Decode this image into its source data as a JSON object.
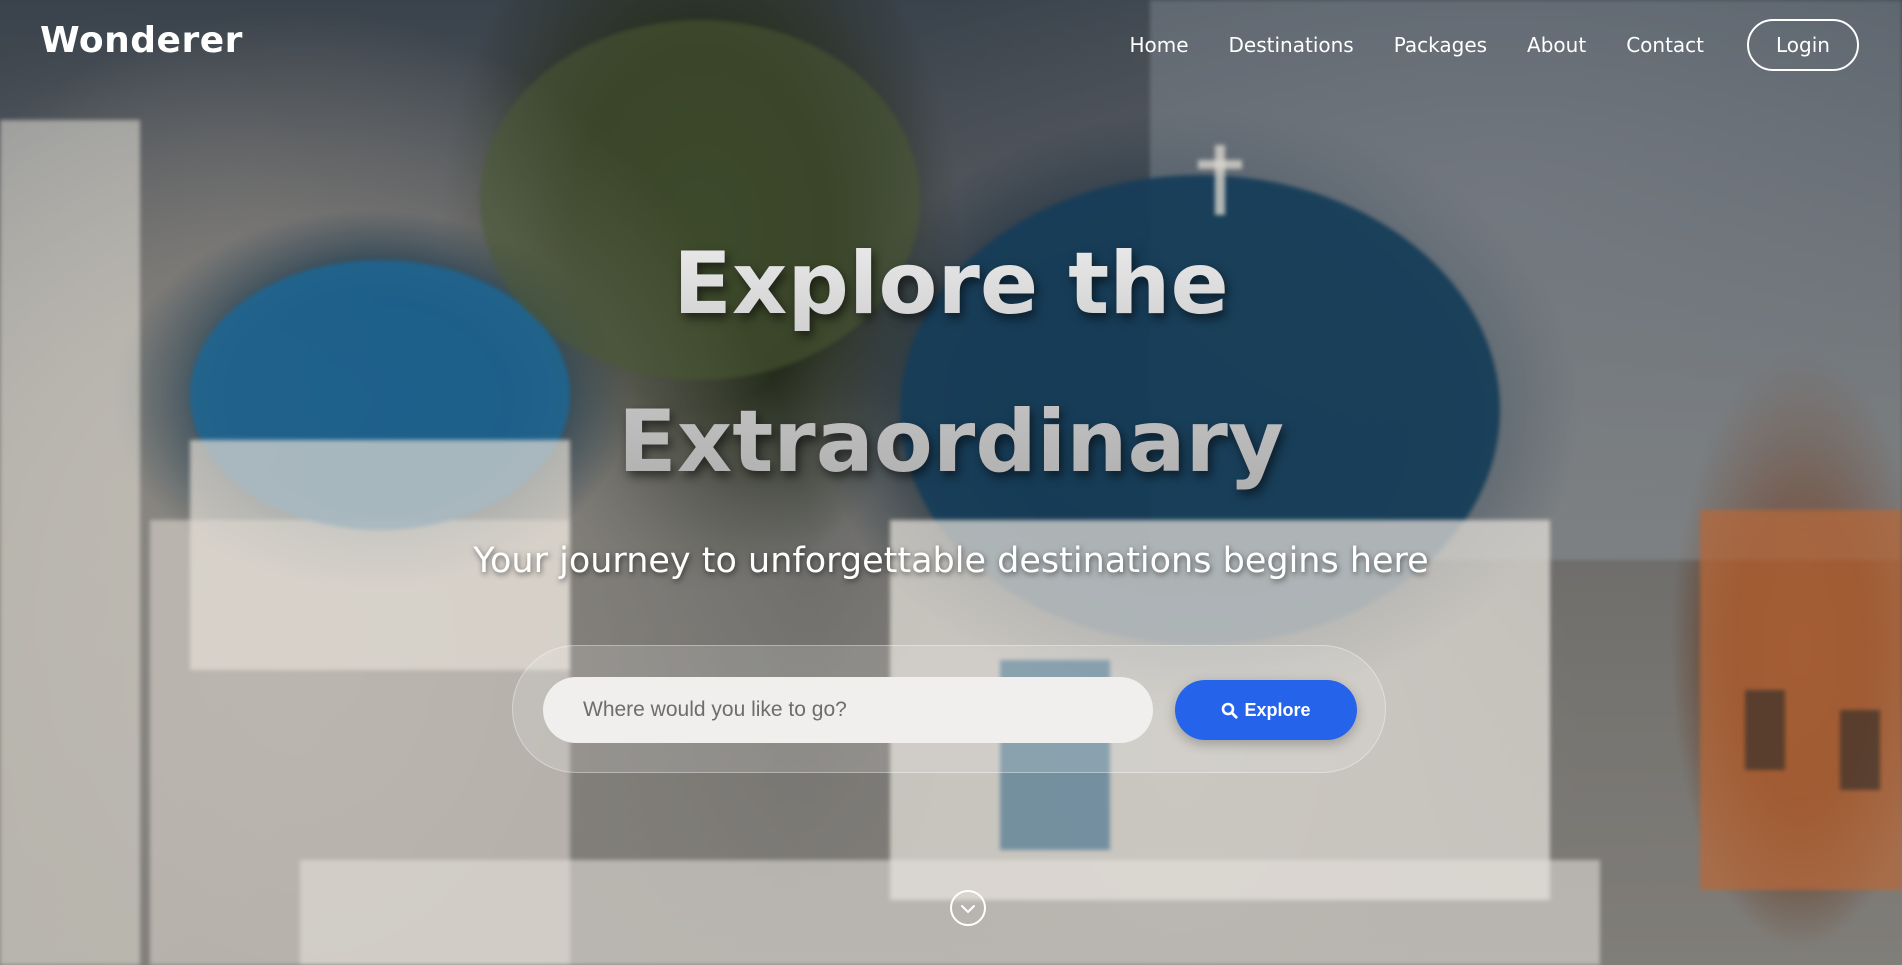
{
  "brand": "Wonderer",
  "nav": {
    "links": [
      "Home",
      "Destinations",
      "Packages",
      "About",
      "Contact"
    ],
    "login_label": "Login"
  },
  "hero": {
    "title_line1": "Explore the",
    "title_line2": "Extraordinary",
    "subtitle": "Your journey to unforgettable destinations begins here"
  },
  "search": {
    "placeholder": "Where would you like to go?",
    "value": "",
    "button_label": "Explore",
    "button_icon": "search-icon"
  },
  "scroll_icon": "chevron-down-icon",
  "colors": {
    "accent": "#2563eb",
    "text": "#ffffff"
  }
}
